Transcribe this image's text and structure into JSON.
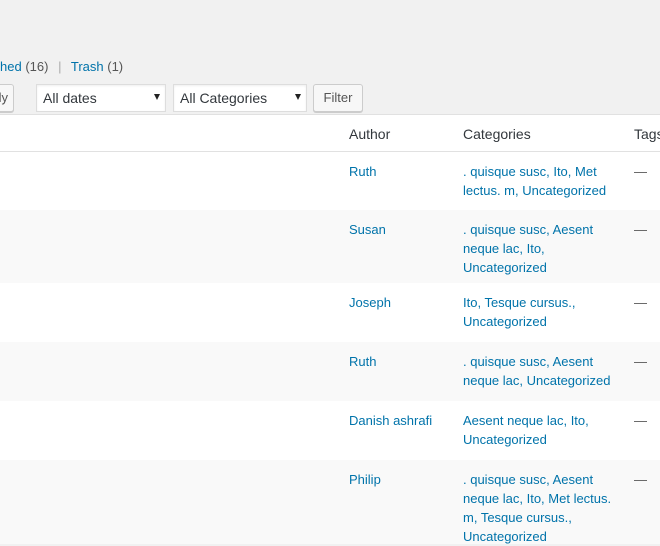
{
  "status_links": {
    "published_text": "hed",
    "published_count": "(16)",
    "separator": "|",
    "trash_label": "Trash",
    "trash_count": "(1)"
  },
  "toolbar": {
    "apply_label": "ly",
    "dates_value": "All dates",
    "categories_value": "All Categories",
    "filter_label": "Filter"
  },
  "table": {
    "headers": {
      "author": "Author",
      "categories": "Categories",
      "tags": "Tags"
    },
    "rows": [
      {
        "author": "Ruth",
        "categories": ". quisque susc, Ito, Met lectus. m, Uncategorized",
        "tags": "—"
      },
      {
        "author": "Susan",
        "categories": ". quisque susc, Aesent neque lac, Ito, Uncategorized",
        "tags": "—"
      },
      {
        "author": "Joseph",
        "categories": "Ito, Tesque cursus., Uncategorized",
        "tags": "—"
      },
      {
        "author": "Ruth",
        "categories": ". quisque susc, Aesent neque lac, Uncategorized",
        "tags": "—"
      },
      {
        "author": "Danish ashrafi",
        "categories": "Aesent neque lac, Ito, Uncategorized",
        "tags": "—"
      },
      {
        "author": "Philip",
        "categories": ". quisque susc, Aesent neque lac, Ito, Met lectus. m, Tesque cursus., Uncategorized",
        "tags": "—"
      }
    ]
  }
}
